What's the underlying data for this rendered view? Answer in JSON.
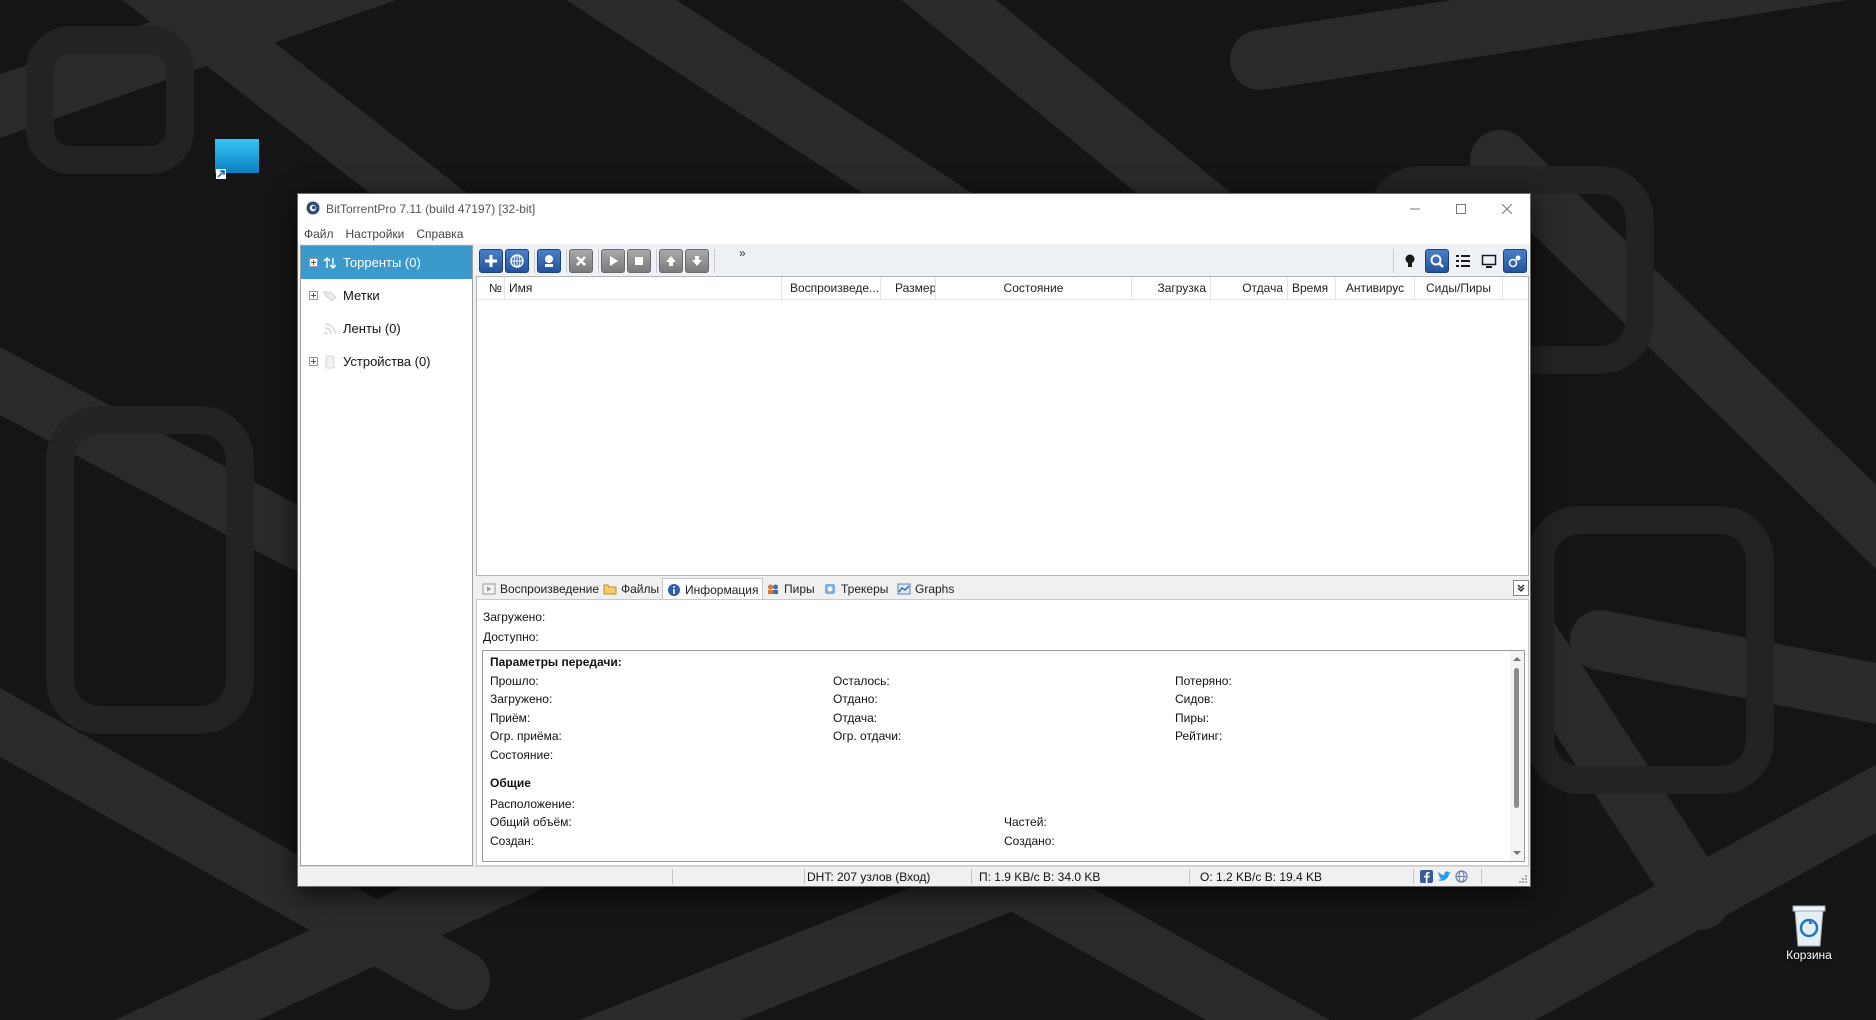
{
  "desktop": {
    "shortcut_label": "",
    "recycle_bin_label": "Корзина"
  },
  "window": {
    "title": "BitTorrentPro 7.11  (build 47197) [32-bit]",
    "controls": {
      "minimize": "minimize-icon",
      "maximize": "maximize-icon",
      "close": "close-icon"
    }
  },
  "menu": [
    "Файл",
    "Настройки",
    "Справка"
  ],
  "sidebar": {
    "items": [
      {
        "label": "Торренты (0)",
        "icon": "arrows-updown-icon",
        "selected": true
      },
      {
        "label": "Метки",
        "icon": "tag-icon"
      },
      {
        "label": "Ленты (0)",
        "icon": "rss-icon"
      },
      {
        "label": "Устройства (0)",
        "icon": "device-icon"
      }
    ]
  },
  "toolbar": {
    "overflow": "»",
    "left_buttons": [
      "add-torrent-icon",
      "add-url-icon",
      "create-torrent-icon",
      "remove-icon",
      "start-icon",
      "stop-icon",
      "move-up-icon",
      "move-down-icon"
    ],
    "right_buttons": [
      "bulb-icon",
      "search-icon",
      "list-view-icon",
      "screen-icon",
      "remote-icon"
    ]
  },
  "list": {
    "columns": [
      "№",
      "Имя",
      "Воспроизведе...",
      "Размер",
      "Состояние",
      "Загрузка",
      "Отдача",
      "Время",
      "Антивирус",
      "Сиды/Пиры"
    ]
  },
  "tabs": [
    {
      "label": "Воспроизведение",
      "icon": "play-tab-icon"
    },
    {
      "label": "Файлы",
      "icon": "folder-icon"
    },
    {
      "label": "Информация",
      "icon": "info-icon",
      "active": true
    },
    {
      "label": "Пиры",
      "icon": "peers-icon"
    },
    {
      "label": "Трекеры",
      "icon": "trackers-icon"
    },
    {
      "label": "Graphs",
      "icon": "graph-icon"
    }
  ],
  "info": {
    "downloaded": "Загружено:",
    "available": "Доступно:",
    "transfer_heading": "Параметры передачи:",
    "col1": [
      "Прошло:",
      "Загружено:",
      "Приём:",
      "Огр. приёма:",
      "Состояние:"
    ],
    "col2": [
      "Осталось:",
      "Отдано:",
      "Отдача:",
      "Огр. отдачи:"
    ],
    "col3": [
      "Потеряно:",
      "Сидов:",
      "Пиры:",
      "Рейтинг:"
    ],
    "general_heading": "Общие",
    "location": "Расположение:",
    "total_size": "Общий объём:",
    "created": "Создан:",
    "pieces": "Частей:",
    "created_by": "Создано:"
  },
  "status": {
    "dht": "DHT: 207 узлов  (Вход)",
    "download": "П: 1.9 KB/с В: 34.0 KB",
    "upload": "О: 1.2 KB/с В: 19.4 KB"
  }
}
